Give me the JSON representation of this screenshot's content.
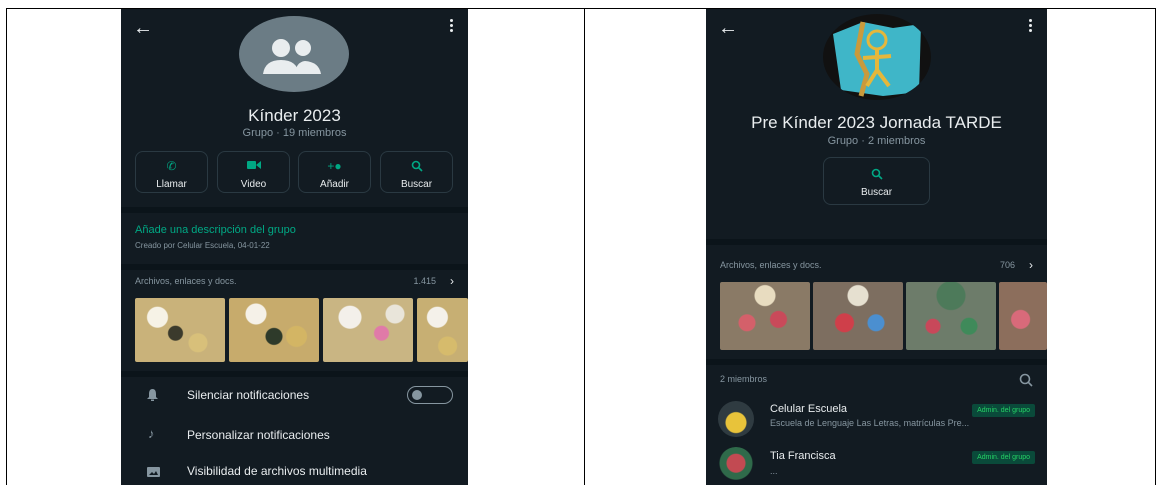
{
  "left": {
    "group_name": "Kínder 2023",
    "group_meta": "Grupo · 19 miembros",
    "actions": [
      {
        "label": "Llamar",
        "icon": "phone-icon"
      },
      {
        "label": "Video",
        "icon": "video-icon"
      },
      {
        "label": "Añadir",
        "icon": "add-person-icon"
      },
      {
        "label": "Buscar",
        "icon": "search-icon"
      }
    ],
    "add_description": "Añade una descripción del grupo",
    "created_by": "Creado por Celular Escuela, 04-01-22",
    "media_label": "Archivos, enlaces y docs.",
    "media_count": "1.415",
    "settings": [
      {
        "label": "Silenciar notificaciones",
        "icon": "bell-icon"
      },
      {
        "label": "Personalizar notificaciones",
        "icon": "music-note-icon"
      },
      {
        "label": "Visibilidad de archivos multimedia",
        "icon": "image-icon"
      }
    ]
  },
  "right": {
    "group_name": "Pre Kínder 2023 Jornada TARDE",
    "group_meta": "Grupo · 2 miembros",
    "search_label": "Buscar",
    "media_label": "Archivos, enlaces y docs.",
    "media_count": "706",
    "members_count": "2 miembros",
    "members": [
      {
        "name": "Celular Escuela",
        "status": "Escuela de Lenguaje Las Letras, matrículas Pre...",
        "badge": "Admin. del grupo"
      },
      {
        "name": "Tia Francisca",
        "status": "...",
        "badge": "Admin. del grupo"
      }
    ]
  },
  "colors": {
    "background": "#121b22",
    "accent": "#00a884",
    "text": "#e9edef",
    "muted": "#8696a0"
  }
}
